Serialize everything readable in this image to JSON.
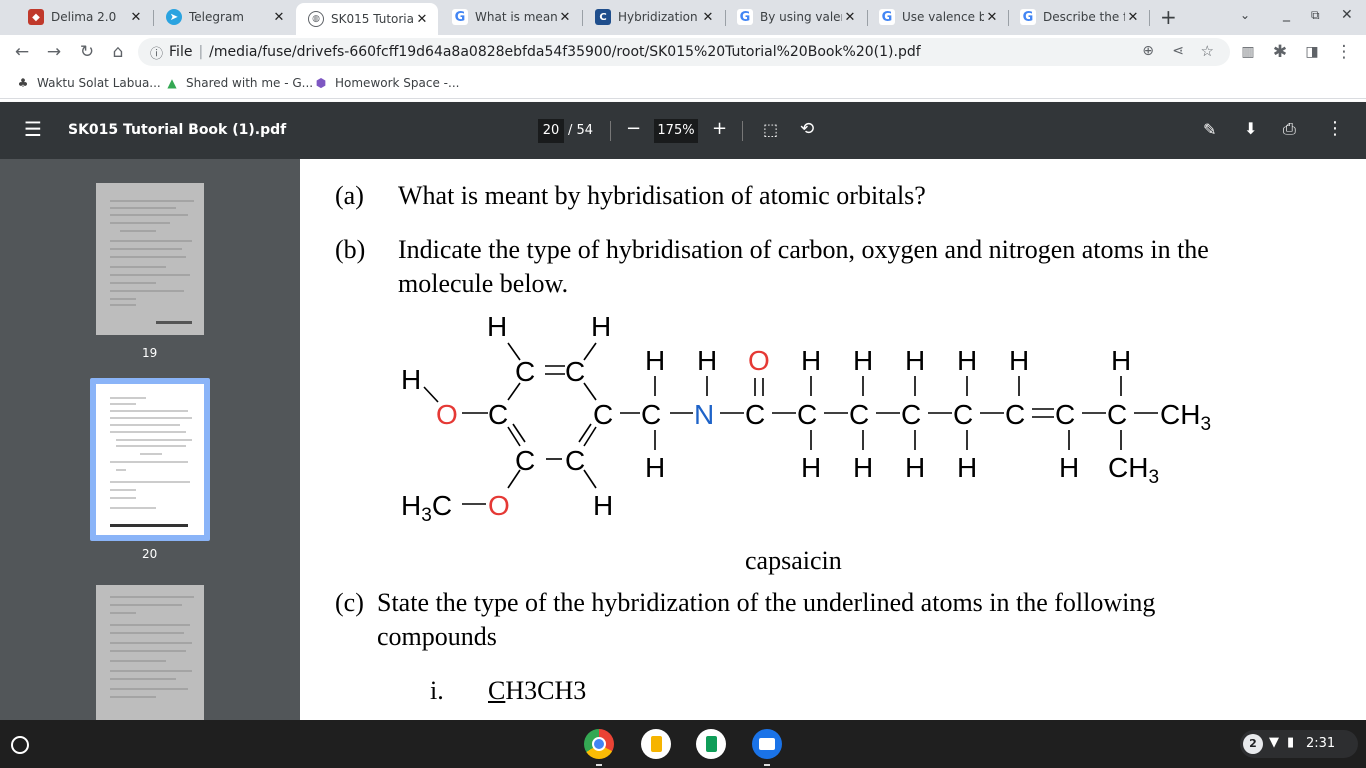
{
  "tabs": [
    {
      "title": "Delima 2.0",
      "icon": "delima-favicon",
      "color": "#c0392b"
    },
    {
      "title": "Telegram",
      "icon": "telegram-icon",
      "color": "#2aa3e0"
    },
    {
      "title": "SK015 Tutoria",
      "icon": "globe-icon",
      "color": "#5f6368"
    },
    {
      "title": "What is meant",
      "icon": "google-icon",
      "color": "#4285f4"
    },
    {
      "title": "Hybridization",
      "icon": "c-icon",
      "color": "#1f4e8c"
    },
    {
      "title": "By using valen",
      "icon": "google-icon",
      "color": "#4285f4"
    },
    {
      "title": "Use valence bo",
      "icon": "google-icon",
      "color": "#4285f4"
    },
    {
      "title": "Describe the fo",
      "icon": "google-icon",
      "color": "#4285f4"
    }
  ],
  "address": {
    "prefix": "File",
    "url": "/media/fuse/drivefs-660fcff19d64a8a0828ebfda54f35900/root/SK015%20Tutorial%20Book%20(1).pdf"
  },
  "bookmarks": [
    {
      "label": "Waktu Solat Labua...",
      "icon": "mosque-icon"
    },
    {
      "label": "Shared with me - G...",
      "icon": "drive-icon"
    },
    {
      "label": "Homework Space -...",
      "icon": "gem-icon"
    }
  ],
  "pdf": {
    "filename": "SK015 Tutorial Book (1).pdf",
    "page": "20",
    "total": "/ 54",
    "zoom": "175%",
    "thumb_pages": [
      "19",
      "20"
    ]
  },
  "doc": {
    "qa_label": "(a)",
    "qa_text": "What is meant by hybridisation of atomic orbitals?",
    "qb_label": "(b)",
    "qb_text_1": "Indicate the type of hybridisation of carbon, oxygen and nitrogen atoms in the",
    "qb_text_2": "molecule below.",
    "molecule_name": "capsaicin",
    "qc_label": "(c)",
    "qc_text_1": "State the type of the hybridization of the underlined atoms in the following",
    "qc_text_2": "compounds",
    "qc_item_label": "i.",
    "qc_item_formula_c": "C",
    "qc_item_formula_rest": "H3CH3"
  },
  "molecule": {
    "H": "H",
    "C": "C",
    "N": "N",
    "O": "O",
    "CH3": "CH3",
    "H3C": "H3C",
    "color_heteroatom_O": "#e53935",
    "color_heteroatom_N": "#1e63c8"
  },
  "status": {
    "notifications": "2",
    "time": "2:31"
  },
  "colors": {
    "tabstrip": "#dee1e6",
    "pdf_toolbar": "#323639",
    "pdf_sidebar": "#525659",
    "thumb_selected": "#8ab4f8"
  }
}
